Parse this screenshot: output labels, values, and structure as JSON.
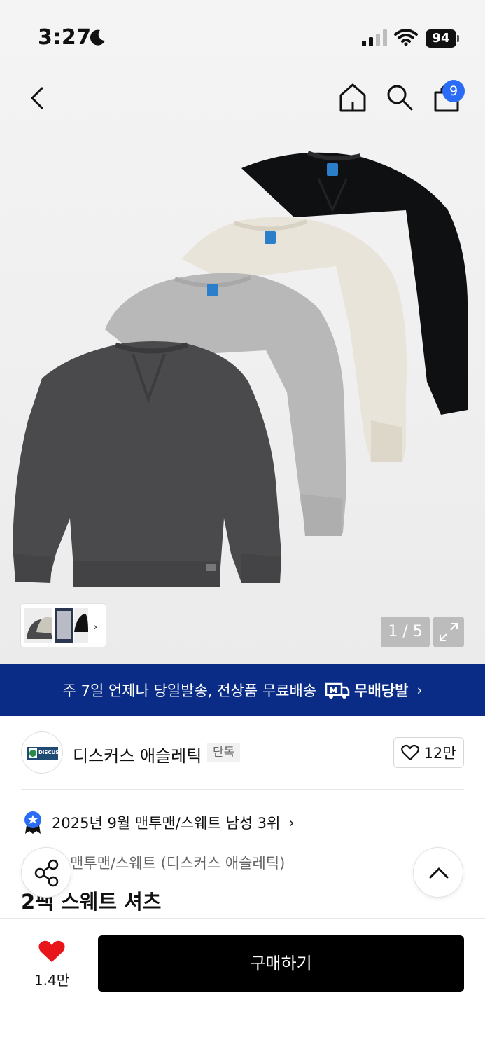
{
  "status_bar": {
    "time": "3:27",
    "battery": "94"
  },
  "header": {
    "cart_count": "9"
  },
  "gallery": {
    "page_indicator": "1 / 5"
  },
  "promo": {
    "text": "주 7일 언제나 당일발송, 전상품 무료배송",
    "brand": "무배당발",
    "icon_text": "M"
  },
  "brand": {
    "name": "디스커스 애슬레틱",
    "tag": "단독",
    "likes": "12만",
    "logo_text": "DISCUS"
  },
  "ranking": {
    "text": "2025년 9월 맨투맨/스웨트 남성 3위"
  },
  "product": {
    "category": "맨투맨/스웨트 (디스커스 애슬레틱)",
    "category_prefix": "ㅁ",
    "title": "2팩 스웨트 셔츠"
  },
  "bottom": {
    "like_count": "1.4만",
    "buy_label": "구매하기"
  },
  "colors": {
    "promo_bg": "#0a2c86",
    "badge_blue": "#2b6cf6",
    "heart_red": "#e8161b",
    "buy_bg": "#000000"
  },
  "sweatshirt_colors": [
    "#0f1012",
    "#e9e4d9",
    "#b8b8b8",
    "#4a4a4c"
  ]
}
